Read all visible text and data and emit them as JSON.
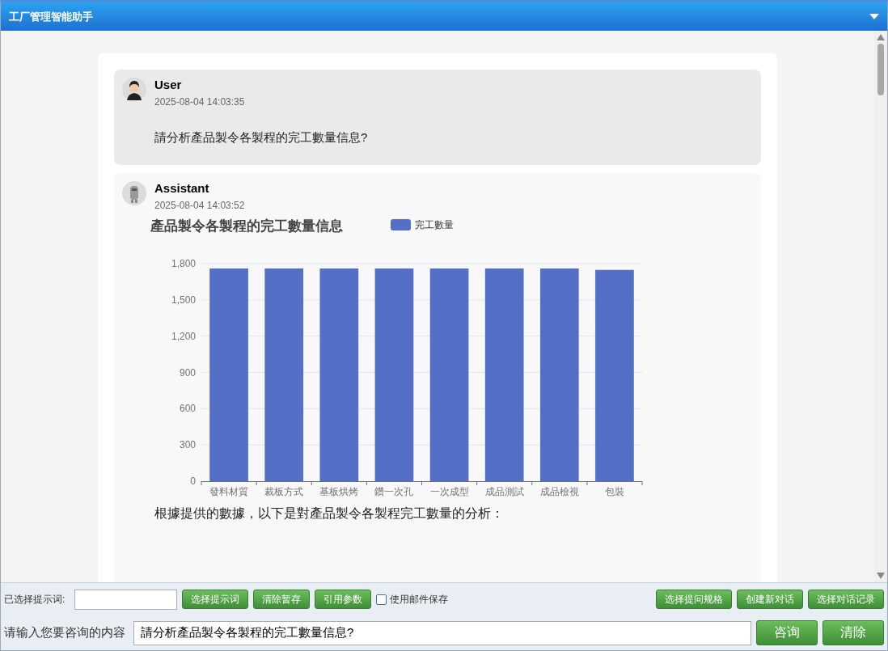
{
  "window": {
    "title": "工厂管理智能助手"
  },
  "messages": [
    {
      "kind": "user",
      "sender": "User",
      "time": "2025-08-04 14:03:35",
      "text": "請分析產品製令各製程的完工數量信息?"
    },
    {
      "kind": "assistant",
      "sender": "Assistant",
      "time": "2025-08-04 14:03:52",
      "chart_data": {
        "type": "bar",
        "title": "產品製令各製程的完工數量信息",
        "categories": [
          "發料材質",
          "裁板方式",
          "基板烘烤",
          "鑽一次孔",
          "一次成型",
          "成品測試",
          "成品檢視",
          "包裝"
        ],
        "series": [
          {
            "name": "完工數量",
            "color": "#5470c6",
            "values": [
              1760,
              1760,
              1760,
              1760,
              1760,
              1760,
              1760,
              1748
            ]
          }
        ],
        "ylim": [
          0,
          1800
        ],
        "yticks": [
          0,
          300,
          600,
          900,
          {
            "value": 1200,
            "label": "1,200"
          },
          {
            "value": 1500,
            "label": "1,500"
          },
          {
            "value": 1800,
            "label": "1,800"
          }
        ],
        "grid": true
      },
      "text": "根據提供的數據，以下是對產品製令各製程完工數量的分析："
    }
  ],
  "toolbar": {
    "prompt_label": "已选择提示词:",
    "left_buttons": [
      "选择提示词",
      "清除暂存",
      "引用参数"
    ],
    "email_save": {
      "label": "使用邮件保存",
      "checked": false
    },
    "right_buttons": [
      "选择提问规格",
      "创建新对话",
      "选择对话记录"
    ]
  },
  "query": {
    "label": "请输入您要咨询的内容",
    "value": "請分析產品製令各製程的完工數量信息?",
    "buttons": [
      "咨询",
      "清除"
    ]
  }
}
